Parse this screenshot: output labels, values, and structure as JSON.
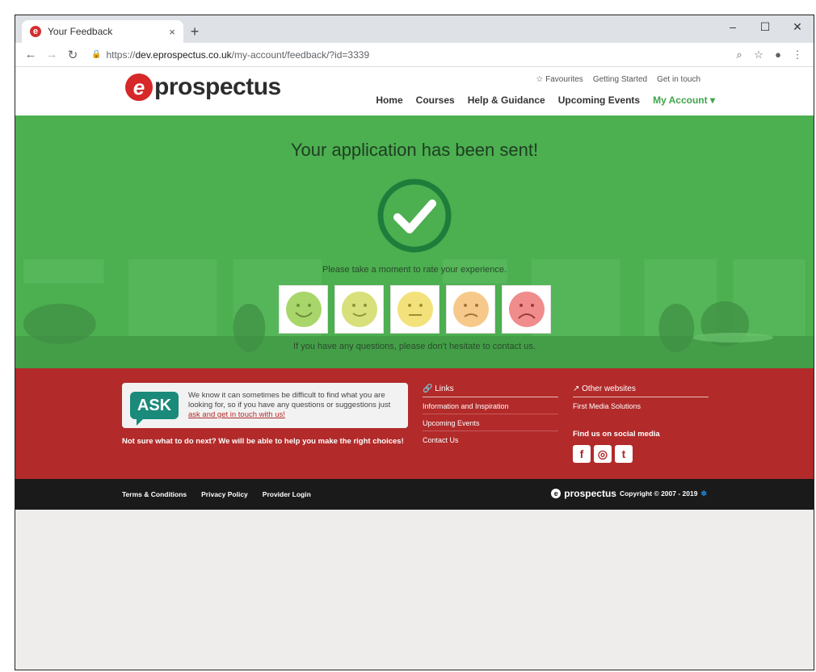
{
  "browser": {
    "tab_title": "Your Feedback",
    "tab_close": "×",
    "new_tab": "+",
    "url_scheme": "https://",
    "url_host": "dev.eprospectus.co.uk",
    "url_path": "/my-account/feedback/?id=3339"
  },
  "header": {
    "logo_text": "prospectus",
    "logo_letter": "e",
    "top_links": [
      "☆ Favourites",
      "Getting Started",
      "Get in touch"
    ],
    "nav": [
      "Home",
      "Courses",
      "Help & Guidance",
      "Upcoming Events",
      "My Account ▾"
    ]
  },
  "hero": {
    "title": "Your application has been sent!",
    "rate_prompt": "Please take a moment to rate your experience.",
    "help_text": "If you have any questions, please don't hesitate to contact us."
  },
  "faces": [
    {
      "color": "#a9d66b",
      "mood": "very-happy"
    },
    {
      "color": "#d7e07a",
      "mood": "happy"
    },
    {
      "color": "#f3e27b",
      "mood": "neutral"
    },
    {
      "color": "#f6c98a",
      "mood": "sad"
    },
    {
      "color": "#f08c8c",
      "mood": "very-sad"
    }
  ],
  "footer": {
    "ask_label": "ASK",
    "ask_text": "We know it can sometimes be difficult to find what you are looking for, so if you have any questions or suggestions just",
    "ask_link": "ask and get in touch with us!",
    "not_sure": "Not sure what to do next? We will be able to help you make the right choices!",
    "links_head": "🔗 Links",
    "links": [
      "Information and Inspiration",
      "Upcoming Events",
      "Contact Us"
    ],
    "other_head": "↗ Other websites",
    "other": [
      "First Media Solutions"
    ],
    "social_head": "Find us on social media",
    "social_icons": [
      "f",
      "◎",
      "t"
    ]
  },
  "bottom": {
    "legal": [
      "Terms & Conditions",
      "Privacy Policy",
      "Provider Login"
    ],
    "logo_text": "prospectus",
    "copyright": "Copyright © 2007 - 2019"
  },
  "colors": {
    "hero_green": "#4caf50",
    "footer_red": "#b22a2a",
    "brand_red": "#d62828",
    "accent_green": "#3fa54a"
  }
}
